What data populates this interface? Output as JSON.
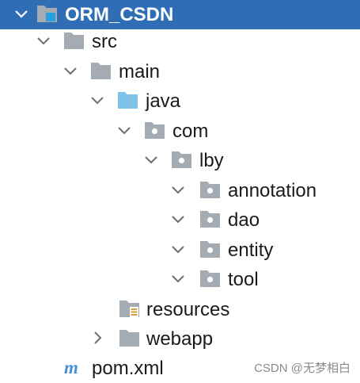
{
  "tree": {
    "root": {
      "label": "ORM_CSDN",
      "icon": "module-folder-icon",
      "state": "expanded",
      "selected": true
    },
    "nodes": [
      {
        "label": "src",
        "icon": "folder-icon",
        "state": "expanded"
      },
      {
        "label": "main",
        "icon": "folder-icon",
        "state": "expanded"
      },
      {
        "label": "java",
        "icon": "source-root-folder-icon",
        "state": "expanded"
      },
      {
        "label": "com",
        "icon": "package-icon",
        "state": "expanded"
      },
      {
        "label": "lby",
        "icon": "package-icon",
        "state": "expanded"
      },
      {
        "label": "annotation",
        "icon": "package-icon",
        "state": "expanded"
      },
      {
        "label": "dao",
        "icon": "package-icon",
        "state": "expanded"
      },
      {
        "label": "entity",
        "icon": "package-icon",
        "state": "expanded"
      },
      {
        "label": "tool",
        "icon": "package-icon",
        "state": "expanded"
      },
      {
        "label": "resources",
        "icon": "resources-root-folder-icon",
        "state": "leaf"
      },
      {
        "label": "webapp",
        "icon": "folder-icon",
        "state": "collapsed"
      },
      {
        "label": "pom.xml",
        "icon": "maven-file-icon",
        "state": "leaf"
      }
    ]
  },
  "watermark": "CSDN @无梦相白",
  "colors": {
    "selection": "#2f6db5",
    "folder": "#a4abb2",
    "source_root": "#7fc3ea",
    "maven": "#4a8fd4",
    "chevron": "#6e6e6e"
  }
}
